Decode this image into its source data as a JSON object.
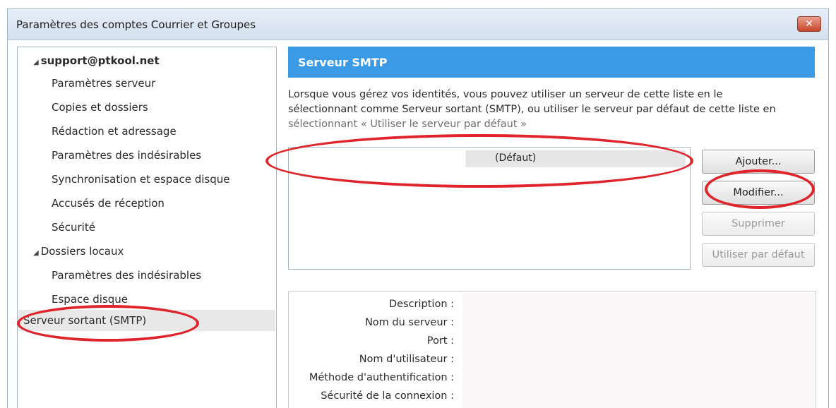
{
  "window": {
    "title": "Paramètres des comptes Courrier et Groupes",
    "close_label": "✕"
  },
  "tree": {
    "account": "support@ptkool.net",
    "account_items": [
      "Paramètres serveur",
      "Copies et dossiers",
      "Rédaction et adressage",
      "Paramètres des indésirables",
      "Synchronisation et espace disque",
      "Accusés de réception",
      "Sécurité"
    ],
    "local_folders": "Dossiers locaux",
    "local_items": [
      "Paramètres des indésirables",
      "Espace disque"
    ],
    "smtp": "Serveur sortant (SMTP)",
    "expander_glyph": "◢"
  },
  "panel": {
    "title": "Serveur SMTP",
    "description_line1": "Lorsque vous gérez vos identités, vous pouvez utiliser un serveur de cette liste en le",
    "description_line2": "sélectionnant comme Serveur sortant (SMTP), ou utiliser le serveur par défaut de cette liste en",
    "description_line3": "sélectionnant « Utiliser le serveur par défaut »"
  },
  "server_list": {
    "rows": [
      {
        "label": "(Défaut)"
      }
    ]
  },
  "buttons": {
    "add": "Ajouter...",
    "edit": "Modifier...",
    "delete": "Supprimer",
    "set_default": "Utiliser par défaut"
  },
  "details": {
    "labels": [
      "Description :",
      "Nom du serveur :",
      "Port :",
      "Nom d'utilisateur :",
      "Méthode d'authentification :",
      "Sécurité de la connexion :"
    ]
  },
  "colors": {
    "header_blue": "#3b9ae6",
    "annotation_red": "#e0242b"
  }
}
